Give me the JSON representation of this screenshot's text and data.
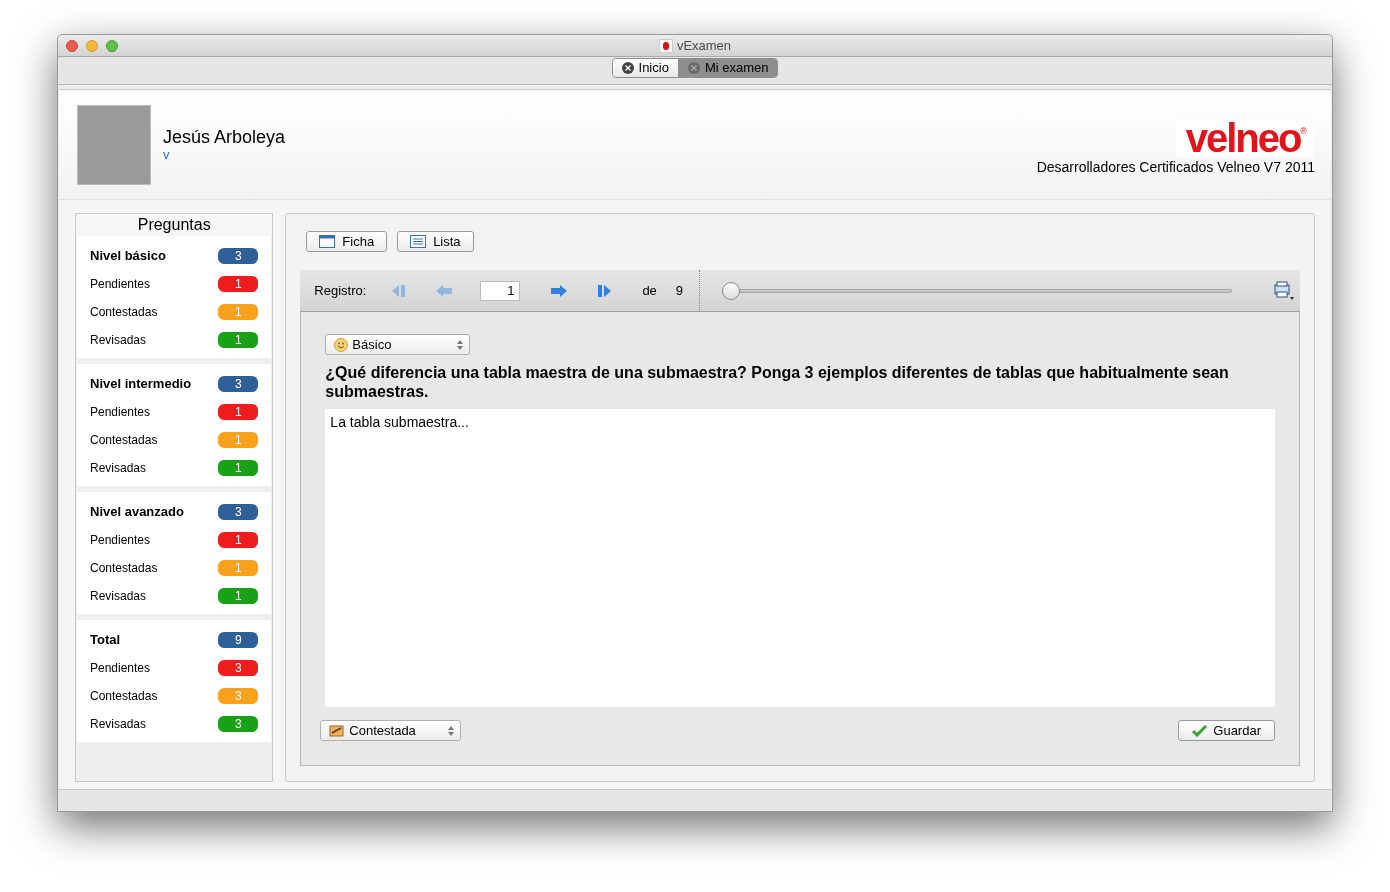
{
  "window": {
    "title": "vExamen"
  },
  "tabs": [
    {
      "label": "Inicio",
      "selected": false
    },
    {
      "label": "Mi examen",
      "selected": true
    }
  ],
  "header": {
    "user_name": "Jesús Arboleya",
    "user_link": "v",
    "logo": "velneo",
    "logo_mark": "®",
    "subtitle": "Desarrolladores Certificados Velneo V7 2011"
  },
  "sidebar": {
    "title": "Preguntas",
    "groups": [
      {
        "rows": [
          {
            "label": "Nivel básico",
            "count": "3",
            "color": "#2f5f97",
            "bold": true
          },
          {
            "label": "Pendientes",
            "count": "1",
            "color": "#ee1c1c",
            "bold": false
          },
          {
            "label": "Contestadas",
            "count": "1",
            "color": "#f9a11b",
            "bold": false
          },
          {
            "label": "Revisadas",
            "count": "1",
            "color": "#17a117",
            "bold": false
          }
        ]
      },
      {
        "rows": [
          {
            "label": "Nivel intermedio",
            "count": "3",
            "color": "#2f5f97",
            "bold": true
          },
          {
            "label": "Pendientes",
            "count": "1",
            "color": "#ee1c1c",
            "bold": false
          },
          {
            "label": "Contestadas",
            "count": "1",
            "color": "#f9a11b",
            "bold": false
          },
          {
            "label": "Revisadas",
            "count": "1",
            "color": "#17a117",
            "bold": false
          }
        ]
      },
      {
        "rows": [
          {
            "label": "Nivel avanzado",
            "count": "3",
            "color": "#2f5f97",
            "bold": true
          },
          {
            "label": "Pendientes",
            "count": "1",
            "color": "#ee1c1c",
            "bold": false
          },
          {
            "label": "Contestadas",
            "count": "1",
            "color": "#f9a11b",
            "bold": false
          },
          {
            "label": "Revisadas",
            "count": "1",
            "color": "#17a117",
            "bold": false
          }
        ]
      },
      {
        "rows": [
          {
            "label": "Total",
            "count": "9",
            "color": "#2f5f97",
            "bold": true
          },
          {
            "label": "Pendientes",
            "count": "3",
            "color": "#ee1c1c",
            "bold": false
          },
          {
            "label": "Contestadas",
            "count": "3",
            "color": "#f9a11b",
            "bold": false
          },
          {
            "label": "Revisadas",
            "count": "3",
            "color": "#17a117",
            "bold": false
          }
        ]
      }
    ]
  },
  "view_buttons": [
    "Ficha",
    "Lista"
  ],
  "navigator": {
    "label": "Registro:",
    "record": "1",
    "of_label": "de",
    "total": "9",
    "level": 0
  },
  "record": {
    "level_select": "Básico",
    "question": "¿Qué diferencia una tabla maestra de una submaestra? Ponga 3 ejemplos diferentes de tablas que habitualmente sean submaestras.",
    "answer": "La tabla submaestra...",
    "status_select": "Contestada",
    "save_button": "Guardar"
  }
}
